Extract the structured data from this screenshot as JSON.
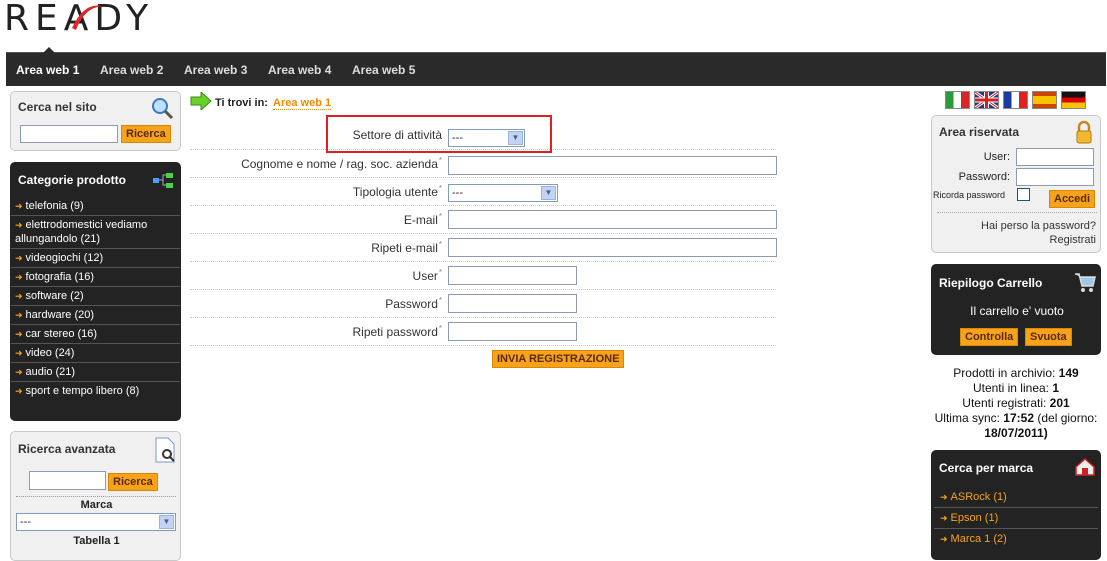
{
  "logo": {
    "text": "READY"
  },
  "nav": {
    "items": [
      "Area web 1",
      "Area web 2",
      "Area web 3",
      "Area web 4",
      "Area web 5"
    ]
  },
  "search": {
    "title": "Cerca nel sito",
    "button": "Ricerca"
  },
  "categories": {
    "title": "Categorie prodotto",
    "items": [
      "telefonia (9)",
      "elettrodomestici vediamo allungandolo (21)",
      "videogiochi (12)",
      "fotografia (16)",
      "software (2)",
      "hardware (20)",
      "car stereo (16)",
      "video (24)",
      "audio (21)",
      "sport e tempo libero (8)"
    ]
  },
  "advanced": {
    "title": "Ricerca avanzata",
    "button": "Ricerca",
    "brand_label": "Marca",
    "brand_value": "---",
    "table_label": "Tabella 1"
  },
  "breadcrumb": {
    "prefix": "Ti trovi in:",
    "link": "Area web 1"
  },
  "form": {
    "fields": [
      {
        "label": "Settore di attività",
        "value": "---"
      },
      {
        "label": "Cognome e nome / rag. soc. azienda",
        "value": ""
      },
      {
        "label": "Tipologia utente",
        "value": "---"
      },
      {
        "label": "E-mail",
        "value": ""
      },
      {
        "label": "Ripeti e-mail",
        "value": ""
      },
      {
        "label": "User",
        "value": ""
      },
      {
        "label": "Password",
        "value": ""
      },
      {
        "label": "Ripeti password",
        "value": ""
      }
    ],
    "required_mark": "*",
    "submit": "INVIA REGISTRAZIONE"
  },
  "reserved": {
    "title": "Area riservata",
    "user_label": "User:",
    "password_label": "Password:",
    "remember_label": "Ricorda password",
    "login_button": "Accedi",
    "lost_link": "Hai perso la password?",
    "register_link": "Registrati"
  },
  "cart": {
    "title": "Riepilogo Carrello",
    "empty_text": "Il carrello e' vuoto",
    "check_button": "Controlla",
    "empty_button": "Svuota"
  },
  "stats": {
    "products_label": "Prodotti in archivio:",
    "products_value": "149",
    "online_label": "Utenti in linea:",
    "online_value": "1",
    "registered_label": "Utenti registrati:",
    "registered_value": "201",
    "sync_label": "Ultima sync:",
    "sync_time": "17:52",
    "sync_mid": "(del giorno:",
    "sync_date": "18/07/2011)"
  },
  "brands": {
    "title": "Cerca per marca",
    "items": [
      "ASRock (1)",
      "Epson (1)",
      "Marca 1 (2)"
    ]
  },
  "colors": {
    "accent": "#f6a21b",
    "dark": "#232323",
    "highlight": "#e02020"
  }
}
